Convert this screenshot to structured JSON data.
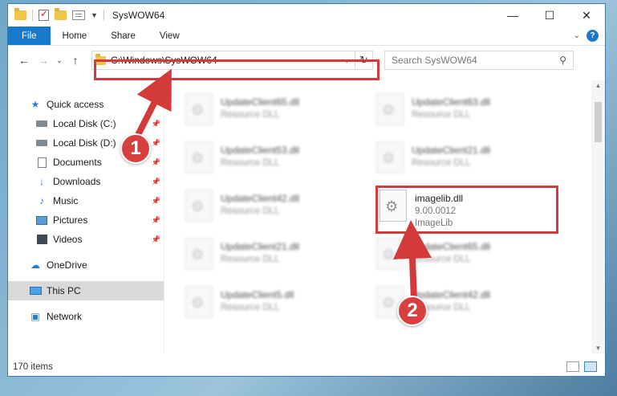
{
  "window": {
    "title": "SysWOW64"
  },
  "ribbon": {
    "tabs": [
      "File",
      "Home",
      "Share",
      "View"
    ],
    "help": "?"
  },
  "address": {
    "path": "C:\\Windows\\SysWOW64",
    "search_placeholder": "Search SysWOW64"
  },
  "nav": {
    "items": [
      {
        "label": "Quick access",
        "icon": "star-icon"
      },
      {
        "label": "Local Disk (C:)",
        "icon": "drive-icon",
        "pinned": true
      },
      {
        "label": "Local Disk (D:)",
        "icon": "drive-icon",
        "pinned": true
      },
      {
        "label": "Documents",
        "icon": "document-icon",
        "pinned": true
      },
      {
        "label": "Downloads",
        "icon": "download-icon",
        "pinned": true
      },
      {
        "label": "Music",
        "icon": "music-icon",
        "pinned": true
      },
      {
        "label": "Pictures",
        "icon": "picture-icon",
        "pinned": true
      },
      {
        "label": "Videos",
        "icon": "video-icon",
        "pinned": true
      },
      {
        "label": "OneDrive",
        "icon": "cloud-icon"
      },
      {
        "label": "This PC",
        "icon": "computer-icon",
        "selected": true
      },
      {
        "label": "Network",
        "icon": "network-icon"
      }
    ]
  },
  "files": [
    {
      "name": "UpdateClient65.dll",
      "type": "Resource DLL"
    },
    {
      "name": "UpdateClient63.dll",
      "type": "Resource DLL"
    },
    {
      "name": "UpdateClient53.dll",
      "type": "Resource DLL"
    },
    {
      "name": "UpdateClient21.dll",
      "type": "Resource DLL"
    },
    {
      "name": "UpdateClient42.dll",
      "type": "Resource DLL"
    },
    {
      "name": "imagelib.dll",
      "version": "9.00.0012",
      "type": "ImageLib"
    },
    {
      "name": "UpdateClient21.dll",
      "type": "Resource DLL"
    },
    {
      "name": "UpdateClient65.dll",
      "type": "Resource DLL"
    },
    {
      "name": "UpdateClient5.dll",
      "type": "Resource DLL"
    },
    {
      "name": "UpdateClient42.dll",
      "type": "Resource DLL"
    }
  ],
  "status": {
    "item_count": "170 items"
  },
  "annotations": {
    "step1": "1",
    "step2": "2",
    "color": "#d43a3a"
  }
}
